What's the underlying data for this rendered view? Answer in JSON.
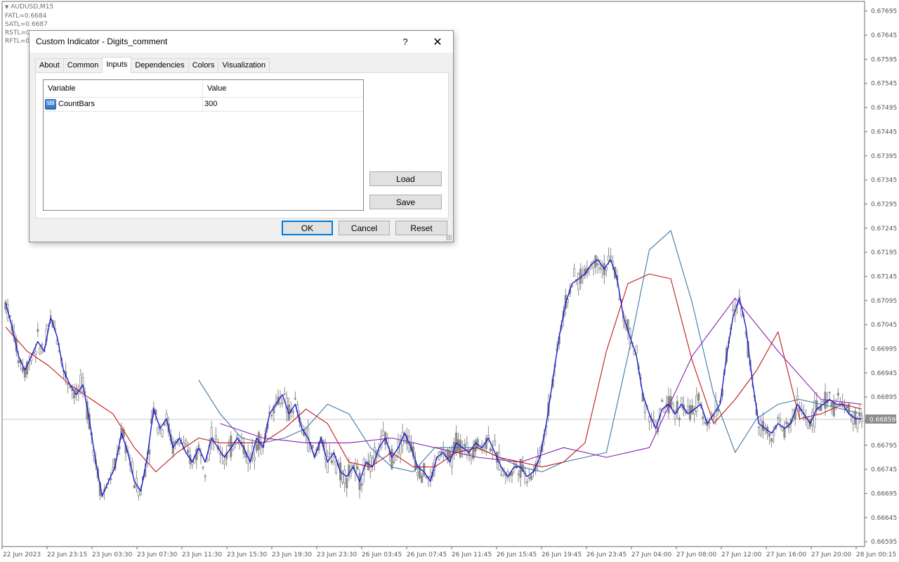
{
  "chart": {
    "symbol": "AUDUSD,M15",
    "legend": [
      "FATL=0.6684",
      "SATL=0.6687",
      "RSTL=0",
      "RFTL=0"
    ],
    "current_price": "0.66859",
    "colors": {
      "candle": "#8c8c8c",
      "fatl": "#1a1ad0",
      "satl": "#c01818",
      "rstl": "#8a1fb0",
      "rftl": "#3b79a8",
      "price_tag": "#8c8c8c"
    }
  },
  "chart_data": {
    "type": "line",
    "title": "AUDUSD,M15",
    "x_ticks": [
      "22 Jun 2023",
      "22 Jun 23:15",
      "23 Jun 03:30",
      "23 Jun 07:30",
      "23 Jun 11:30",
      "23 Jun 15:30",
      "23 Jun 19:30",
      "23 Jun 23:30",
      "26 Jun 03:45",
      "26 Jun 07:45",
      "26 Jun 11:45",
      "26 Jun 15:45",
      "26 Jun 19:45",
      "26 Jun 23:45",
      "27 Jun 04:00",
      "27 Jun 08:00",
      "27 Jun 12:00",
      "27 Jun 16:00",
      "27 Jun 20:00",
      "28 Jun 00:15"
    ],
    "y_ticks": [
      "0.67695",
      "0.67645",
      "0.67595",
      "0.67545",
      "0.67495",
      "0.67445",
      "0.67395",
      "0.67345",
      "0.67295",
      "0.67245",
      "0.67195",
      "0.67145",
      "0.67095",
      "0.67045",
      "0.66995",
      "0.66945",
      "0.66895",
      "0.66845",
      "0.66795",
      "0.66745",
      "0.66695",
      "0.66645",
      "0.66595"
    ],
    "ylim": [
      0.66585,
      0.67715
    ],
    "series": [
      {
        "name": "FATL",
        "color": "#1a1ad0",
        "x": [
          0,
          3,
          6,
          9,
          12,
          15,
          18,
          21,
          24,
          27,
          30,
          33,
          36,
          39,
          42,
          45,
          48,
          51,
          54,
          57,
          60,
          63,
          66,
          69,
          72,
          75,
          78,
          81,
          84,
          87,
          90,
          93,
          96,
          99,
          102,
          105,
          108,
          111,
          114,
          117,
          120,
          123,
          126,
          129,
          132,
          135,
          138,
          141,
          144,
          147,
          150,
          153,
          156,
          159,
          162,
          165,
          168,
          171,
          174,
          177,
          180,
          183,
          186,
          189,
          192,
          195,
          198,
          201,
          204,
          207,
          210,
          213,
          216,
          219,
          222,
          225,
          228,
          231,
          234,
          237,
          240,
          243,
          246,
          249,
          252,
          255,
          258,
          261,
          264,
          267,
          270,
          273,
          276,
          279,
          282,
          285,
          288,
          291,
          294,
          297,
          300,
          303,
          306,
          309,
          312,
          315,
          318,
          321,
          324,
          327,
          330,
          333,
          336,
          339,
          342,
          345,
          348,
          351,
          354,
          357,
          360,
          363,
          366,
          369,
          372,
          375,
          378,
          381,
          384,
          387,
          390,
          393,
          396,
          399
        ],
        "y": [
          0.6709,
          0.6704,
          0.6698,
          0.6695,
          0.6698,
          0.6701,
          0.6699,
          0.6706,
          0.6702,
          0.6695,
          0.6692,
          0.669,
          0.6692,
          0.6685,
          0.6676,
          0.6669,
          0.6672,
          0.6675,
          0.6682,
          0.6678,
          0.6672,
          0.667,
          0.6677,
          0.6687,
          0.6683,
          0.6685,
          0.6679,
          0.6681,
          0.6678,
          0.6676,
          0.6679,
          0.6676,
          0.6681,
          0.6679,
          0.6677,
          0.6679,
          0.6681,
          0.6679,
          0.6676,
          0.6681,
          0.6679,
          0.6686,
          0.6688,
          0.669,
          0.6686,
          0.6688,
          0.6683,
          0.6681,
          0.6677,
          0.6681,
          0.6676,
          0.6678,
          0.6674,
          0.6673,
          0.6675,
          0.6672,
          0.6676,
          0.6675,
          0.6679,
          0.6681,
          0.6677,
          0.6679,
          0.6682,
          0.6679,
          0.6675,
          0.6674,
          0.6672,
          0.6677,
          0.6678,
          0.6676,
          0.668,
          0.6679,
          0.6678,
          0.668,
          0.6679,
          0.6681,
          0.6678,
          0.6675,
          0.6673,
          0.6675,
          0.6675,
          0.6673,
          0.6674,
          0.6677,
          0.6684,
          0.6693,
          0.6702,
          0.6709,
          0.6713,
          0.6714,
          0.6715,
          0.6717,
          0.6718,
          0.6716,
          0.6718,
          0.6714,
          0.6706,
          0.6702,
          0.6698,
          0.669,
          0.6686,
          0.6683,
          0.6687,
          0.6688,
          0.6686,
          0.6688,
          0.6686,
          0.6687,
          0.6688,
          0.6684,
          0.6686,
          0.6688,
          0.6698,
          0.6706,
          0.671,
          0.6704,
          0.6693,
          0.6684,
          0.6683,
          0.6682,
          0.6684,
          0.6683,
          0.6684,
          0.6688,
          0.6686,
          0.6684,
          0.6687,
          0.6688,
          0.6689,
          0.6688,
          0.6688,
          0.6686,
          0.6685,
          0.6685
        ]
      },
      {
        "name": "SATL",
        "color": "#c01818",
        "x": [
          0,
          10,
          20,
          30,
          40,
          50,
          60,
          70,
          80,
          90,
          100,
          110,
          120,
          130,
          140,
          150,
          160,
          170,
          180,
          190,
          200,
          210,
          220,
          230,
          240,
          250,
          260,
          270,
          280,
          290,
          300,
          310,
          320,
          330,
          340,
          350,
          360,
          370,
          380,
          390,
          399
        ],
        "y": [
          0.6704,
          0.6699,
          0.6696,
          0.6692,
          0.6689,
          0.6686,
          0.6679,
          0.6674,
          0.6678,
          0.6681,
          0.668,
          0.668,
          0.668,
          0.6683,
          0.6687,
          0.6684,
          0.6676,
          0.6675,
          0.6678,
          0.6675,
          0.6675,
          0.6678,
          0.6679,
          0.6677,
          0.6676,
          0.6675,
          0.6676,
          0.668,
          0.6699,
          0.6713,
          0.6715,
          0.6714,
          0.6697,
          0.6684,
          0.6689,
          0.6695,
          0.6703,
          0.6685,
          0.6686,
          0.6688,
          0.6687
        ]
      },
      {
        "name": "RSTL",
        "color": "#8a1fb0",
        "x": [
          100,
          120,
          140,
          160,
          180,
          200,
          220,
          240,
          260,
          280,
          300,
          320,
          340,
          360,
          380,
          399
        ],
        "y": [
          0.6684,
          0.6681,
          0.668,
          0.668,
          0.6681,
          0.6679,
          0.6677,
          0.6676,
          0.6679,
          0.6677,
          0.6679,
          0.6698,
          0.671,
          0.6699,
          0.6689,
          0.6688
        ]
      },
      {
        "name": "RFTL",
        "color": "#3b79a8",
        "x": [
          90,
          100,
          110,
          120,
          130,
          140,
          150,
          160,
          170,
          180,
          190,
          200,
          210,
          220,
          230,
          240,
          250,
          260,
          270,
          280,
          290,
          300,
          310,
          320,
          330,
          340,
          350,
          360,
          370,
          380,
          390,
          399
        ],
        "y": [
          0.6693,
          0.6686,
          0.6681,
          0.668,
          0.6681,
          0.6683,
          0.6688,
          0.6686,
          0.6679,
          0.6675,
          0.6674,
          0.6679,
          0.6679,
          0.6679,
          0.6677,
          0.6675,
          0.6674,
          0.6676,
          0.6677,
          0.6678,
          0.6698,
          0.672,
          0.6724,
          0.6709,
          0.669,
          0.6678,
          0.6685,
          0.6688,
          0.6689,
          0.6688,
          0.6687,
          0.6686
        ]
      }
    ],
    "grid": false,
    "legend_position": "top-left"
  },
  "dialog": {
    "title": "Custom Indicator - Digits_comment",
    "help_label": "?",
    "close_label": "✕",
    "tabs": [
      "About",
      "Common",
      "Inputs",
      "Dependencies",
      "Colors",
      "Visualization"
    ],
    "active_tab": "Inputs",
    "grid": {
      "col_variable": "Variable",
      "col_value": "Value",
      "rows": [
        {
          "icon": "integer-icon",
          "icon_text": "123",
          "variable": "CountBars",
          "value": "300"
        }
      ]
    },
    "load_label": "Load",
    "save_label": "Save",
    "ok_label": "OK",
    "cancel_label": "Cancel",
    "reset_label": "Reset"
  }
}
